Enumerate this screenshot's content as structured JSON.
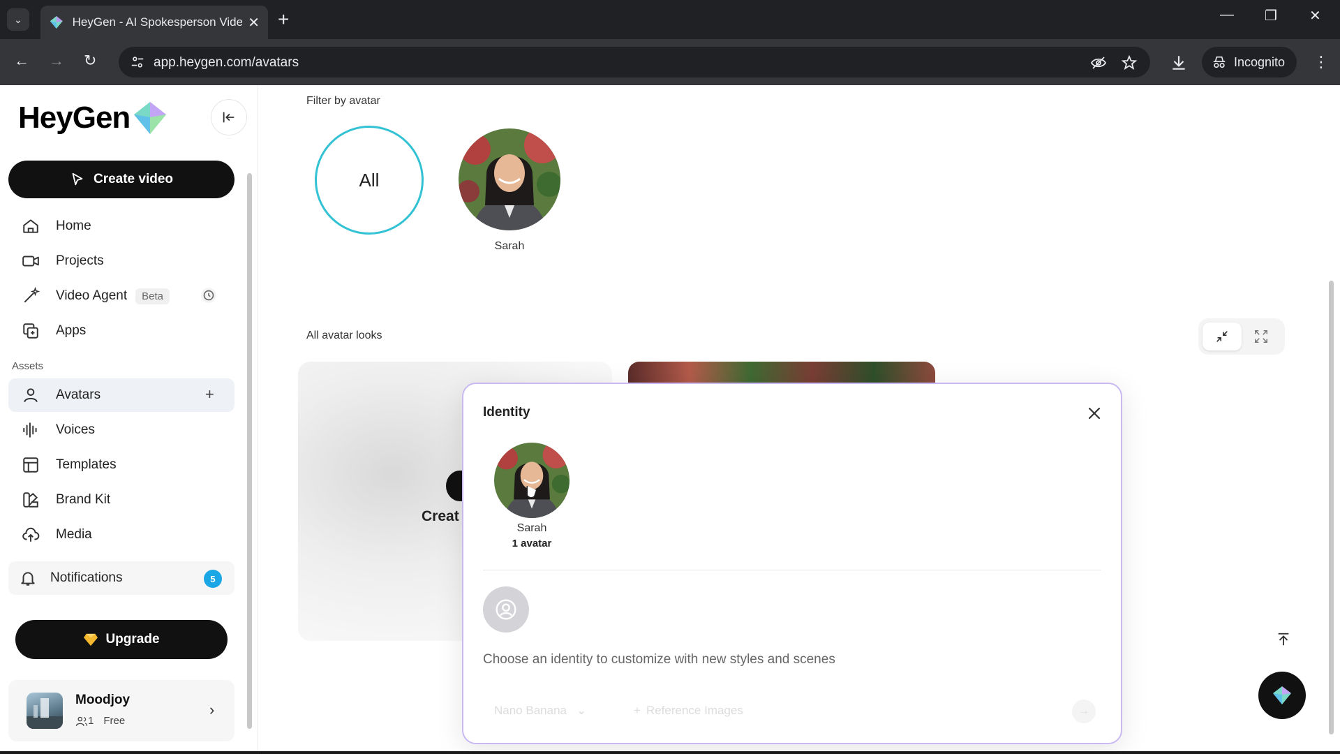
{
  "browser": {
    "tab_title": "HeyGen - AI Spokesperson Video",
    "tab_close": "✕",
    "new_tab": "+",
    "url": "app.heygen.com/avatars",
    "incognito_label": "Incognito"
  },
  "sidebar": {
    "logo_text": "HeyGen",
    "create_video_label": "Create video",
    "nav": [
      {
        "label": "Home",
        "icon": "home-icon"
      },
      {
        "label": "Projects",
        "icon": "video-camera-icon"
      },
      {
        "label": "Video Agent",
        "icon": "magic-wand-icon",
        "badge": "Beta"
      },
      {
        "label": "Apps",
        "icon": "apps-icon"
      }
    ],
    "assets_label": "Assets",
    "assets": [
      {
        "label": "Avatars",
        "icon": "person-icon",
        "active": true
      },
      {
        "label": "Voices",
        "icon": "waveform-icon"
      },
      {
        "label": "Templates",
        "icon": "template-icon"
      },
      {
        "label": "Brand Kit",
        "icon": "brand-kit-icon"
      },
      {
        "label": "Media",
        "icon": "cloud-upload-icon"
      }
    ],
    "notifications_label": "Notifications",
    "notifications_count": "5",
    "upgrade_label": "Upgrade",
    "account": {
      "name": "Moodjoy",
      "members": "1",
      "plan": "Free"
    }
  },
  "main": {
    "filter_label": "Filter by avatar",
    "filter_all": "All",
    "filter_avatar_name": "Sarah",
    "all_looks_label": "All avatar looks",
    "create_partial": "Creat"
  },
  "modal": {
    "title": "Identity",
    "identity_name": "Sarah",
    "identity_count": "1 avatar",
    "hint": "Choose an identity to customize with new styles and scenes",
    "model_label": "Nano Banana",
    "reference_label": "Reference Images"
  },
  "colors": {
    "accent_teal": "#33c2d4",
    "modal_border": "#c9b9f2",
    "badge_blue": "#1ba7e6",
    "upgrade_gem": "#f5b82e"
  }
}
